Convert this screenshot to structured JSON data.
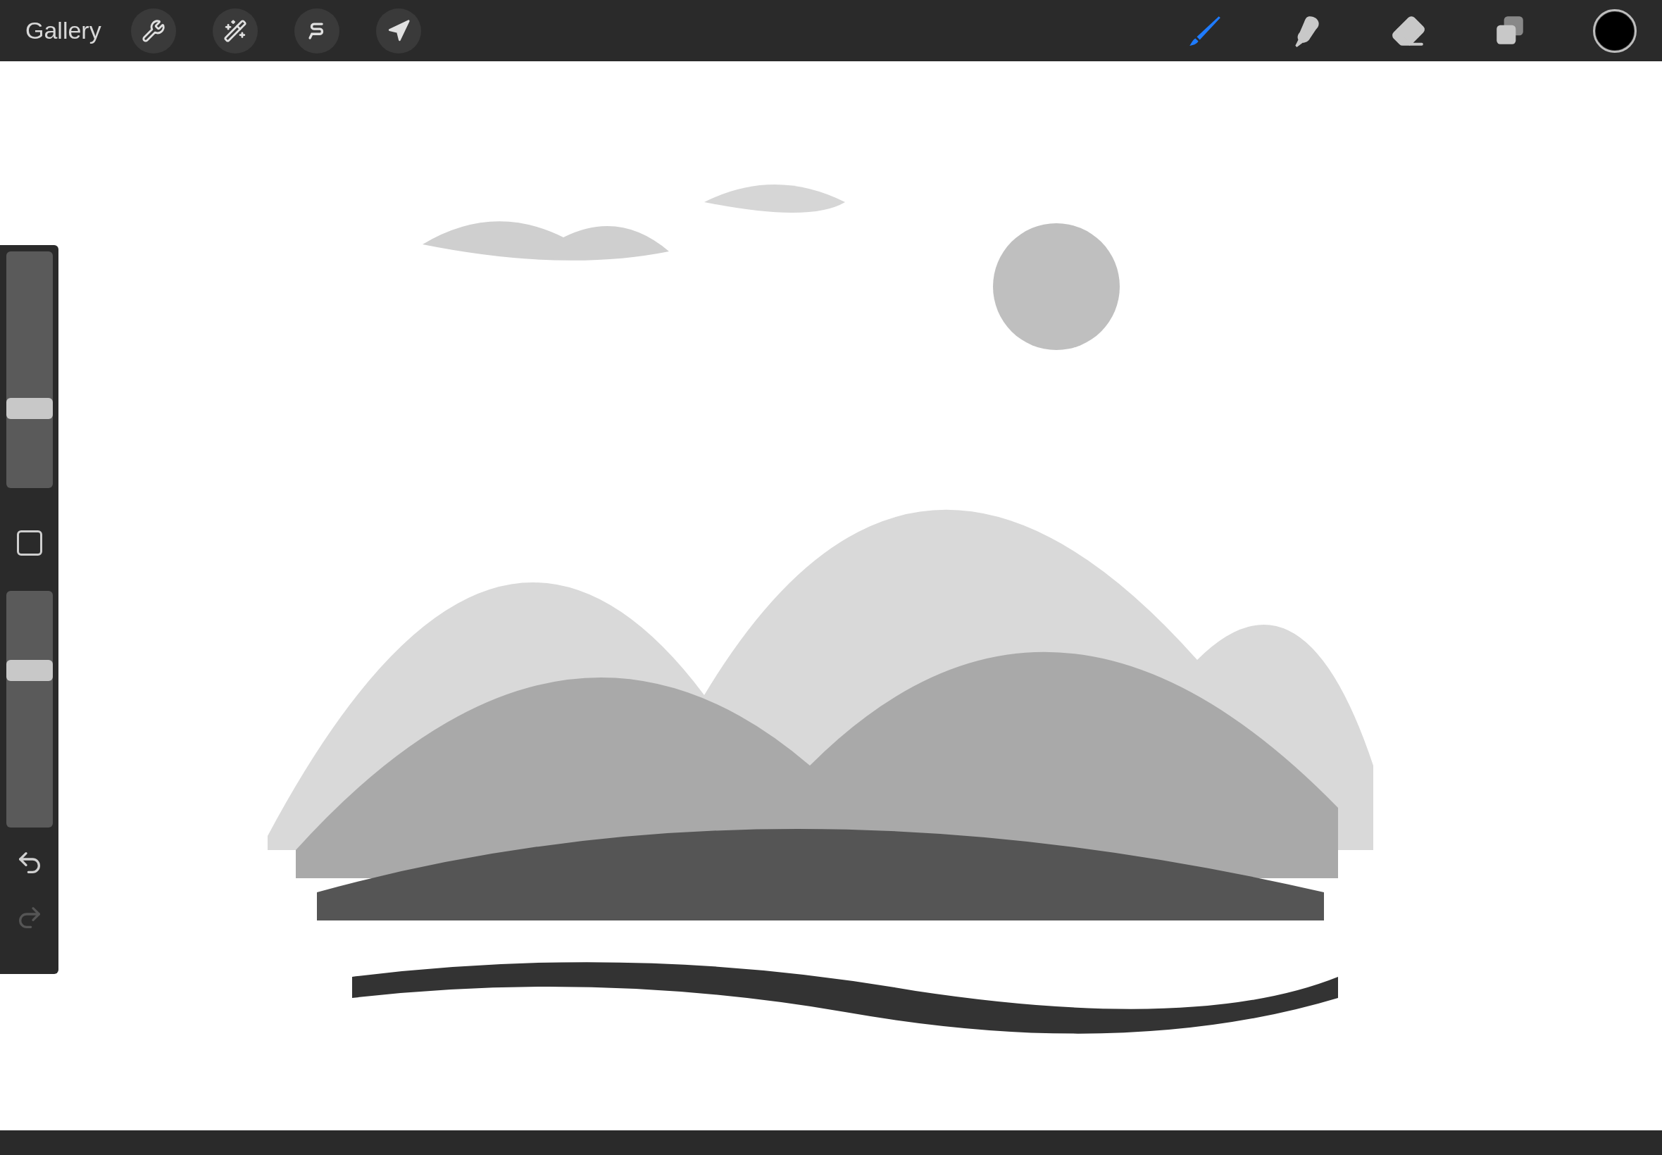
{
  "top_bar": {
    "gallery": "Gallery",
    "actions": [
      {
        "kind": "adjustments",
        "selected": false
      },
      {
        "kind": "magic",
        "selected": false
      },
      {
        "kind": "selection",
        "selected": false
      },
      {
        "kind": "transform",
        "selected": false
      }
    ],
    "tools": [
      {
        "kind": "brush",
        "selected": true
      },
      {
        "kind": "smudge",
        "selected": false
      },
      {
        "kind": "eraser",
        "selected": false
      },
      {
        "kind": "layers",
        "selected": false
      }
    ],
    "color": "#000000"
  },
  "sidebar": {
    "size_slider": {
      "level": 0.32
    },
    "opacity_slider": {
      "level": 0.68
    },
    "undo": {
      "disabled": false
    },
    "redo": {
      "disabled": true
    }
  }
}
